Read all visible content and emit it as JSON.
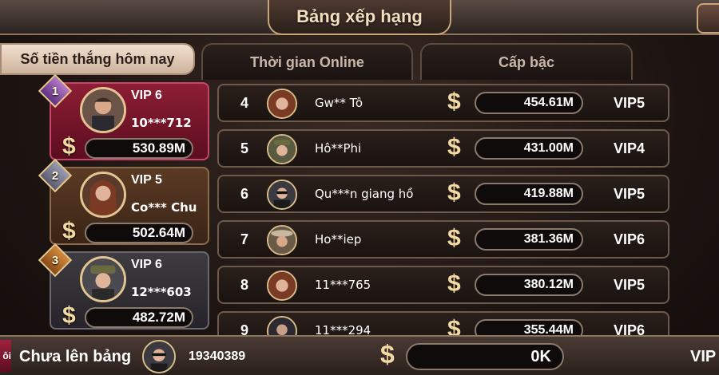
{
  "header": {
    "title": "Bảng xếp hạng"
  },
  "tabs": [
    {
      "label": "Số tiền thắng hôm nay",
      "active": true
    },
    {
      "label": "Thời gian Online",
      "active": false
    },
    {
      "label": "Cấp bậc",
      "active": false
    }
  ],
  "top3": [
    {
      "rank": "1",
      "vip": "VIP 6",
      "name": "10***712",
      "amount": "530.89M"
    },
    {
      "rank": "2",
      "vip": "VIP 5",
      "name": "Co*** Chu",
      "amount": "502.64M"
    },
    {
      "rank": "3",
      "vip": "VIP 6",
      "name": "12***603",
      "amount": "482.72M"
    }
  ],
  "rows": [
    {
      "rank": "4",
      "name": "Gw** Tô",
      "amount": "454.61M",
      "vip": "VIP5"
    },
    {
      "rank": "5",
      "name": "Hô**Phi",
      "amount": "431.00M",
      "vip": "VIP4"
    },
    {
      "rank": "6",
      "name": "Qu***n giang hồ",
      "amount": "419.88M",
      "vip": "VIP5"
    },
    {
      "rank": "7",
      "name": "Ho**iep",
      "amount": "381.36M",
      "vip": "VIP6"
    },
    {
      "rank": "8",
      "name": "11***765",
      "amount": "380.12M",
      "vip": "VIP5"
    },
    {
      "rank": "9",
      "name": "11***294",
      "amount": "355.44M",
      "vip": "VIP6"
    }
  ],
  "currency_symbol": "$",
  "bottom": {
    "tag": "ôi",
    "label": "Chưa lên bảng",
    "id": "19340389",
    "amount": "0K",
    "vip": "VIP"
  },
  "colors": {
    "gold": "#f3d9a2",
    "rank1": "#8d1e35",
    "rank2": "#5a3a24",
    "rank3": "#3e3c40"
  }
}
